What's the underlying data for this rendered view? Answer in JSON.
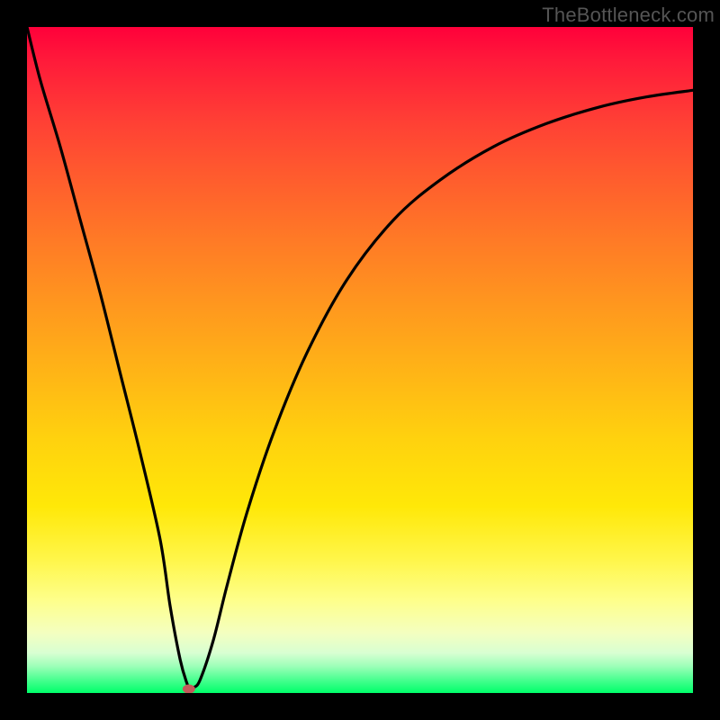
{
  "watermark": "TheBottleneck.com",
  "chart_data": {
    "type": "line",
    "title": "",
    "xlabel": "",
    "ylabel": "",
    "xlim": [
      0,
      100
    ],
    "ylim": [
      0,
      100
    ],
    "series": [
      {
        "name": "bottleneck-curve",
        "x": [
          0,
          2,
          5,
          8,
          11,
          14,
          17,
          20,
          21.5,
          23,
          24,
          24.5,
          25,
          26,
          28,
          30,
          33,
          37,
          42,
          48,
          55,
          62,
          70,
          78,
          86,
          93,
          100
        ],
        "values": [
          100,
          92,
          82,
          71,
          60,
          48,
          36,
          23,
          13,
          5,
          1.5,
          0.6,
          0.8,
          2,
          8,
          16,
          27,
          39,
          51,
          62,
          71,
          77,
          82,
          85.5,
          88,
          89.5,
          90.5
        ]
      }
    ],
    "marker": {
      "x": 24.3,
      "y": 0.6,
      "color": "#c45a5a"
    },
    "background_gradient": {
      "top": "#ff003a",
      "bottom": "#00ff6a"
    }
  }
}
